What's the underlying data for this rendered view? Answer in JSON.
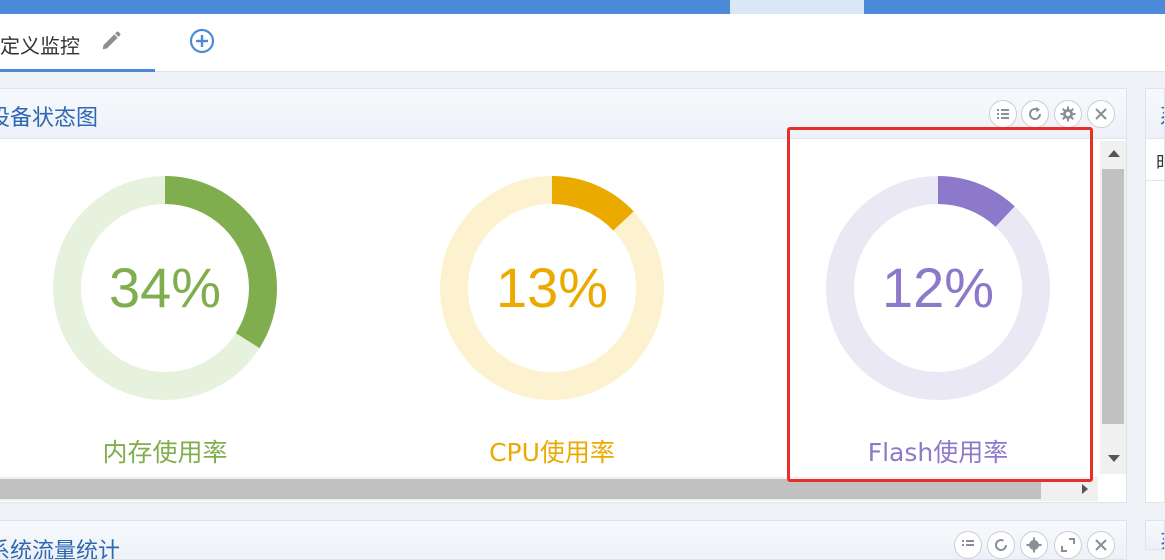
{
  "tabs": [
    {
      "label": "预定义监控",
      "active": true
    }
  ],
  "device_panel": {
    "title": "设备状态图",
    "gauges": [
      {
        "value_text": "34%",
        "percent": 34,
        "label": "内存使用率",
        "color": "#80ae4e",
        "track": "#e7f2de"
      },
      {
        "value_text": "13%",
        "percent": 13,
        "label": "CPU使用率",
        "color": "#eaaa00",
        "track": "#fdf2cf"
      },
      {
        "value_text": "12%",
        "percent": 12,
        "label": "Flash使用率",
        "color": "#8c79c9",
        "track": "#ebe8f6"
      }
    ]
  },
  "traffic_panel": {
    "title": "系统流量统计"
  },
  "side_panel": {
    "title_char": "系",
    "column_char": "时"
  },
  "side_panel2": {
    "title_char": "系"
  },
  "icons": [
    "pencil-icon",
    "add-circle-icon",
    "list-icon",
    "refresh-icon",
    "gear-icon",
    "close-icon",
    "expand-icon"
  ],
  "colors": {
    "accent": "#4a8ad8",
    "title": "#2e67b4",
    "highlight": "#e5302a"
  }
}
